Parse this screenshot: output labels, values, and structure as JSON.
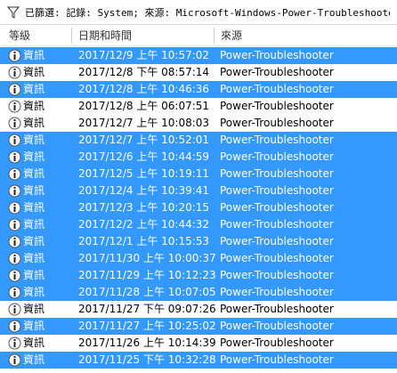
{
  "filter": {
    "icon": "funnel-icon",
    "text": "已篩選: 記錄: System; 來源: Microsoft-Windows-Power-Troubleshooter"
  },
  "columns": {
    "level": "等級",
    "datetime": "日期和時間",
    "source": "來源"
  },
  "colors": {
    "selection": "#3399ff",
    "info_icon_blue": "#2a6fc9"
  },
  "rows": [
    {
      "level": "資訊",
      "datetime": "2017/12/9 上午 10:57:02",
      "source": "Power-Troubleshooter",
      "selected": true
    },
    {
      "level": "資訊",
      "datetime": "2017/12/8 下午 08:57:14",
      "source": "Power-Troubleshooter",
      "selected": false
    },
    {
      "level": "資訊",
      "datetime": "2017/12/8 上午 10:46:36",
      "source": "Power-Troubleshooter",
      "selected": true
    },
    {
      "level": "資訊",
      "datetime": "2017/12/8 上午 06:07:51",
      "source": "Power-Troubleshooter",
      "selected": false
    },
    {
      "level": "資訊",
      "datetime": "2017/12/7 上午 10:08:03",
      "source": "Power-Troubleshooter",
      "selected": false
    },
    {
      "level": "資訊",
      "datetime": "2017/12/7 上午 10:52:01",
      "source": "Power-Troubleshooter",
      "selected": true
    },
    {
      "level": "資訊",
      "datetime": "2017/12/6 上午 10:44:59",
      "source": "Power-Troubleshooter",
      "selected": true
    },
    {
      "level": "資訊",
      "datetime": "2017/12/5 上午 10:19:11",
      "source": "Power-Troubleshooter",
      "selected": true
    },
    {
      "level": "資訊",
      "datetime": "2017/12/4 上午 10:39:41",
      "source": "Power-Troubleshooter",
      "selected": true
    },
    {
      "level": "資訊",
      "datetime": "2017/12/3 上午 10:20:15",
      "source": "Power-Troubleshooter",
      "selected": true
    },
    {
      "level": "資訊",
      "datetime": "2017/12/2 上午 10:44:32",
      "source": "Power-Troubleshooter",
      "selected": true
    },
    {
      "level": "資訊",
      "datetime": "2017/12/1 上午 10:15:53",
      "source": "Power-Troubleshooter",
      "selected": true
    },
    {
      "level": "資訊",
      "datetime": "2017/11/30 上午 10:00:37",
      "source": "Power-Troubleshooter",
      "selected": true
    },
    {
      "level": "資訊",
      "datetime": "2017/11/29 上午 10:12:23",
      "source": "Power-Troubleshooter",
      "selected": true
    },
    {
      "level": "資訊",
      "datetime": "2017/11/28 上午 10:07:05",
      "source": "Power-Troubleshooter",
      "selected": true
    },
    {
      "level": "資訊",
      "datetime": "2017/11/27 下午 09:07:26",
      "source": "Power-Troubleshooter",
      "selected": false
    },
    {
      "level": "資訊",
      "datetime": "2017/11/27 上午 10:25:02",
      "source": "Power-Troubleshooter",
      "selected": true
    },
    {
      "level": "資訊",
      "datetime": "2017/11/26 上午 10:14:39",
      "source": "Power-Troubleshooter",
      "selected": false
    },
    {
      "level": "資訊",
      "datetime": "2017/11/25 下午 10:32:28",
      "source": "Power-Troubleshooter",
      "selected": true
    }
  ]
}
